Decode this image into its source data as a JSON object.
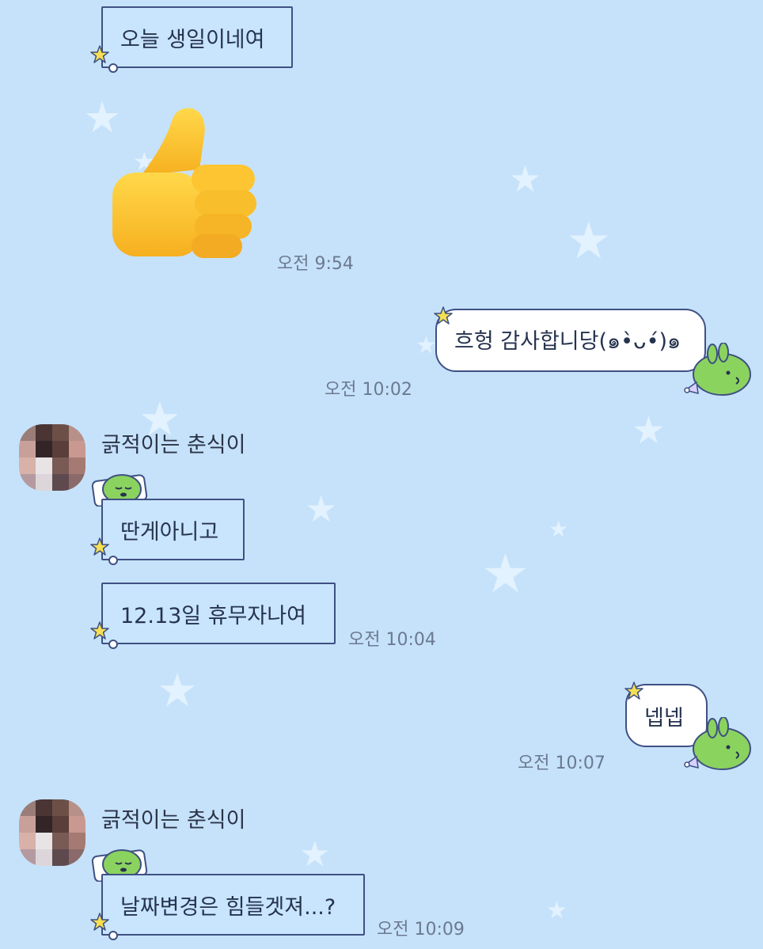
{
  "colors": {
    "background": "#c6e2fa",
    "bubble_in": "#c8e5fd",
    "bubble_out": "#ffffff",
    "bubble_border": "#3f5083",
    "timestamp": "#6b7a90",
    "star_accent": "#f6df52",
    "mascot_green": "#8bd35f"
  },
  "messages": [
    {
      "type": "text",
      "direction": "incoming",
      "text": "오늘 생일이네여"
    },
    {
      "type": "emoji",
      "direction": "incoming",
      "icon": "thumbs-up-emoji",
      "time": "오전 9:54"
    },
    {
      "type": "text",
      "direction": "outgoing",
      "text": "흐헝 감사합니당(๑•̀ᴗ•́)๑",
      "time": "오전 10:02"
    },
    {
      "type": "group",
      "direction": "incoming",
      "sender": "긁적이는 춘식이",
      "items": [
        {
          "text": "딴게아니고"
        },
        {
          "text": "12.13일 휴무자나여",
          "time": "오전 10:04"
        }
      ]
    },
    {
      "type": "text",
      "direction": "outgoing",
      "text": "넵넵",
      "time": "오전 10:07"
    },
    {
      "type": "group",
      "direction": "incoming",
      "sender": "긁적이는 춘식이",
      "items": [
        {
          "text": "날짜변경은 힘들겟져...?",
          "time": "오전 10:09"
        }
      ]
    }
  ]
}
